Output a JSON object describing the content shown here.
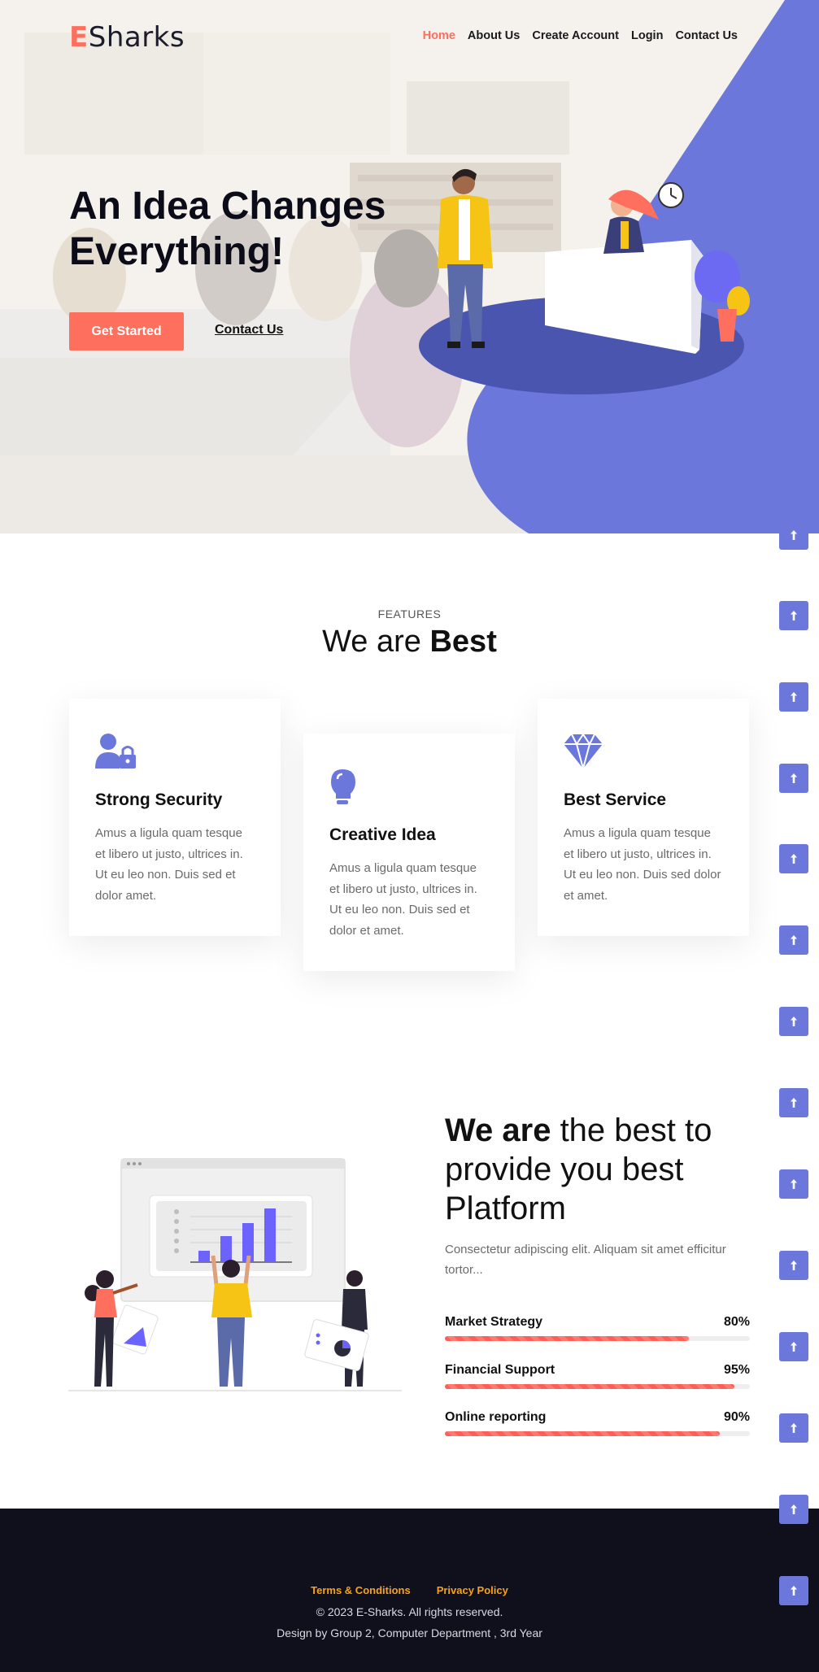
{
  "nav": {
    "logo_initial": "E",
    "logo_rest": "Sharks",
    "items": [
      {
        "label": "Home",
        "active": true
      },
      {
        "label": "About Us",
        "active": false
      },
      {
        "label": "Create Account",
        "active": false
      },
      {
        "label": "Login",
        "active": false
      },
      {
        "label": "Contact Us",
        "active": false
      }
    ]
  },
  "hero": {
    "headline": "An Idea Changes Everything!",
    "primary_button": "Get Started",
    "secondary_link": "Contact Us"
  },
  "features": {
    "eyebrow": "FEATURES",
    "title_light": "We are ",
    "title_bold": "Best",
    "cards": [
      {
        "icon": "user-lock-icon",
        "title": "Strong Security",
        "text": "Amus a ligula quam tesque et libero ut justo, ultrices in. Ut eu leo non. Duis sed et dolor amet."
      },
      {
        "icon": "lightbulb-icon",
        "title": "Creative Idea",
        "text": "Amus a ligula quam tesque et libero ut justo, ultrices in. Ut eu leo non. Duis sed et dolor et amet."
      },
      {
        "icon": "diamond-icon",
        "title": "Best Service",
        "text": "Amus a ligula quam tesque et libero ut justo, ultrices in. Ut eu leo non. Duis sed dolor et amet."
      }
    ]
  },
  "about": {
    "title_bold": "We are",
    "title_rest": " the best to provide you best Platform",
    "text": "Consectetur adipiscing elit. Aliquam sit amet efficitur tortor...",
    "skills": [
      {
        "label": "Market Strategy",
        "percent_label": "80%",
        "value": 80
      },
      {
        "label": "Financial Support",
        "percent_label": "95%",
        "value": 95
      },
      {
        "label": "Online reporting",
        "percent_label": "90%",
        "value": 90
      }
    ]
  },
  "footer": {
    "links": [
      "Terms & Conditions",
      "Privacy Policy"
    ],
    "copyright": "© 2023 E-Sharks. All rights reserved.",
    "credit": "Design by Group 2, Computer Department , 3rd Year"
  },
  "colors": {
    "accent": "#ff6f5e",
    "primary": "#6c77dc",
    "footer_bg": "#10101c",
    "footer_link": "#f7a21b"
  },
  "scroll_top_icon": "arrow-up-icon"
}
